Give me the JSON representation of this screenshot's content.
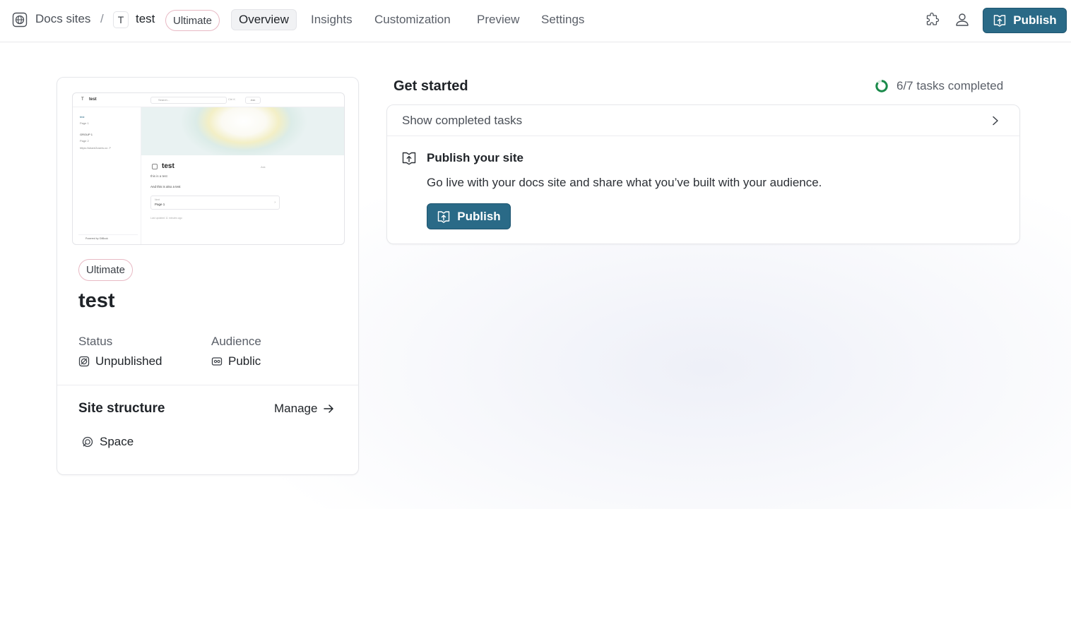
{
  "breadcrumb": {
    "root": "Docs sites",
    "separator": "/",
    "site_initial": "T",
    "site_name": "test",
    "plan": "Ultimate"
  },
  "tabs": [
    {
      "label": "Overview",
      "active": true
    },
    {
      "label": "Insights",
      "active": false
    },
    {
      "label": "Customization",
      "active": false
    },
    {
      "label": "Preview",
      "active": false
    },
    {
      "label": "Settings",
      "active": false
    }
  ],
  "toolbar": {
    "extensions_icon": "puzzle-icon",
    "share_icon": "users-icon",
    "publish_label": "Publish",
    "accent_color": "#2a6a87"
  },
  "site_card": {
    "preview": {
      "initial": "T",
      "title": "test",
      "search_placeholder": "Search...",
      "shortcut": "Ctrl K",
      "ask_label": "Ask",
      "sidebar": [
        "test",
        "Page 1",
        "GROUP 1",
        "Page 2",
        "https://share2users.co ↗"
      ],
      "heading": "test",
      "line1": "this is a test",
      "line2": "And this is also a test",
      "next_small": "Next",
      "next_label": "Page 1",
      "updated": "Last updated 11 minutes ago",
      "powered": "Powered by GitBook"
    },
    "plan": "Ultimate",
    "title": "test",
    "status_label": "Status",
    "status_value": "Unpublished",
    "audience_label": "Audience",
    "audience_value": "Public",
    "structure_title": "Site structure",
    "manage_label": "Manage",
    "structure_items": [
      {
        "label": "Space",
        "icon": "space-icon"
      }
    ]
  },
  "get_started": {
    "title": "Get started",
    "progress_text": "6/7 tasks completed",
    "progress_fraction": 0.857,
    "progress_color": "#1a8a4a",
    "show_completed_label": "Show completed tasks",
    "task": {
      "title": "Publish your site",
      "description": "Go live with your docs site and share what you’ve built with your audience.",
      "button_label": "Publish"
    }
  }
}
